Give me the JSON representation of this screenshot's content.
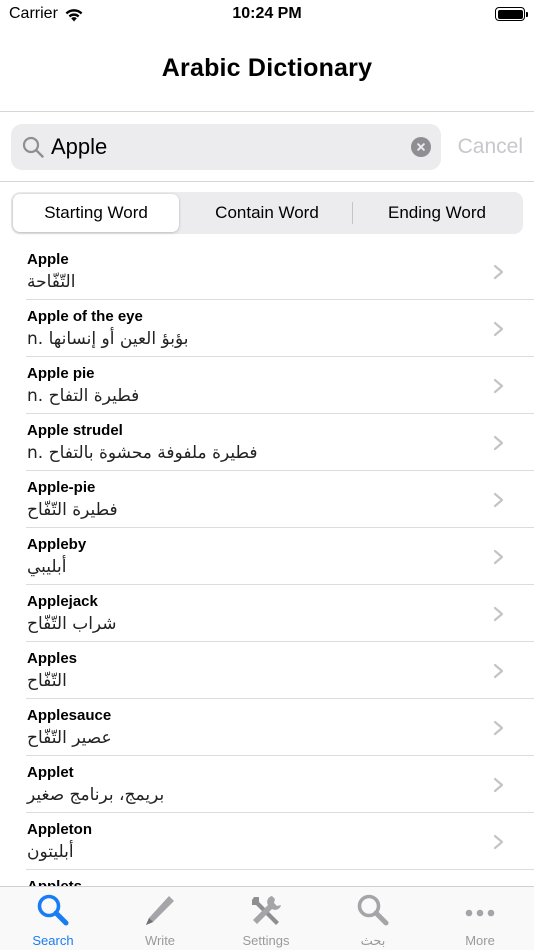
{
  "status_bar": {
    "carrier": "Carrier",
    "time": "10:24 PM"
  },
  "nav": {
    "title": "Arabic Dictionary"
  },
  "search": {
    "query": "Apple",
    "cancel_label": "Cancel"
  },
  "segments": [
    {
      "label": "Starting Word",
      "selected": true
    },
    {
      "label": "Contain Word",
      "selected": false
    },
    {
      "label": "Ending Word",
      "selected": false
    }
  ],
  "results": [
    {
      "word": "Apple",
      "meaning": "التّفّاحة"
    },
    {
      "word": "Apple of the eye",
      "meaning": "n.   بؤبؤ العين أو إنسانها"
    },
    {
      "word": "Apple pie",
      "meaning": "n.   فطيرة التفاح"
    },
    {
      "word": "Apple strudel",
      "meaning": "n.   فطيرة ملفوفة محشوة بالتفاح"
    },
    {
      "word": "Apple-pie",
      "meaning": "فطيرة التّفّاح"
    },
    {
      "word": "Appleby",
      "meaning": "أبليبي"
    },
    {
      "word": "Applejack",
      "meaning": "شراب التّفّاح"
    },
    {
      "word": "Apples",
      "meaning": "التّفّاح"
    },
    {
      "word": "Applesauce",
      "meaning": "عصير التّفّاح"
    },
    {
      "word": "Applet",
      "meaning": "بريمج، برنامج صغير"
    },
    {
      "word": "Appleton",
      "meaning": "أبليتون"
    },
    {
      "word": "Applets",
      "meaning": ""
    }
  ],
  "tabs": [
    {
      "label": "Search",
      "icon": "search-icon",
      "active": true
    },
    {
      "label": "Write",
      "icon": "pencil-icon",
      "active": false
    },
    {
      "label": "Settings",
      "icon": "tools-icon",
      "active": false
    },
    {
      "label": "بحث",
      "icon": "search-icon",
      "active": false
    },
    {
      "label": "More",
      "icon": "more-dots-icon",
      "active": false
    }
  ],
  "colors": {
    "accent": "#1a7cf5",
    "inactive": "#9a9a9e",
    "field_bg": "#ececee",
    "cancel_disabled": "#c7c7cc"
  }
}
